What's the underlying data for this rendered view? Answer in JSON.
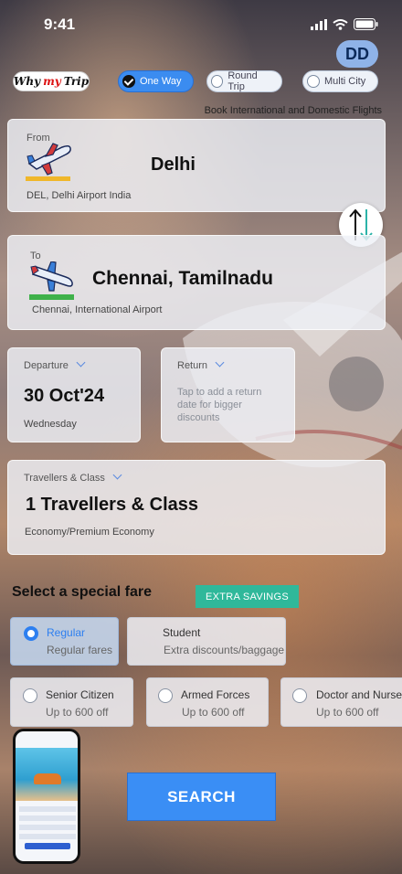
{
  "status": {
    "time": "9:41"
  },
  "avatar": {
    "initials": "DD"
  },
  "logo": {
    "word1": "Why",
    "word2": "my",
    "word3": "Trip"
  },
  "trip_types": [
    {
      "label": "One Way",
      "active": true
    },
    {
      "label": "Round Trip",
      "active": false
    },
    {
      "label": "Multi City",
      "active": false
    }
  ],
  "tagline": "Book International and Domestic Flights",
  "from": {
    "label": "From",
    "city": "Delhi",
    "airport": "DEL, Delhi Airport India"
  },
  "to": {
    "label": "To",
    "city": "Chennai, Tamilnadu",
    "airport": "Chennai, International Airport"
  },
  "departure": {
    "label": "Departure",
    "date": "30 Oct'24",
    "day": "Wednesday"
  },
  "return": {
    "label": "Return",
    "hint": "Tap to add a return date for bigger discounts"
  },
  "travellers": {
    "label": "Travellers & Class",
    "value": "1 Travellers & Class",
    "class": "Economy/Premium Economy"
  },
  "special_fare": {
    "title": "Select a special fare",
    "badge": "EXTRA SAVINGS",
    "options": [
      {
        "title": "Regular",
        "sub": "Regular fares",
        "selected": true
      },
      {
        "title": "Student",
        "sub": "Extra discounts/baggage",
        "selected": false
      },
      {
        "title": "Senior Citizen",
        "sub": "Up to  600 off",
        "selected": false
      },
      {
        "title": "Armed Forces",
        "sub": "Up to  600 off",
        "selected": false
      },
      {
        "title": "Doctor and Nurses",
        "sub": "Up to  600 off",
        "selected": false
      }
    ]
  },
  "search_button": "SEARCH",
  "colors": {
    "accent": "#3a8ef5",
    "badge": "#2fb89a",
    "swap_teal": "#2bb3a8"
  }
}
